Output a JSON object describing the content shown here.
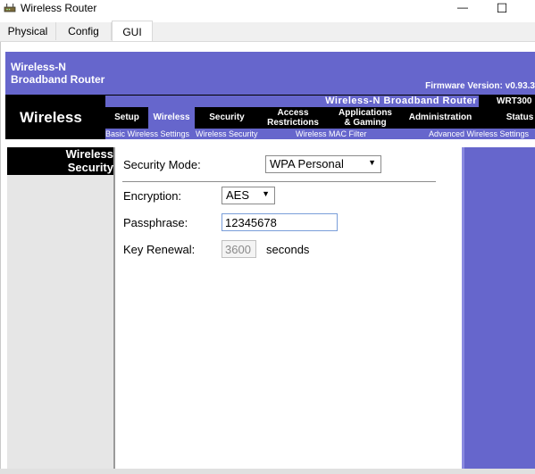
{
  "window": {
    "title": "Wireless Router",
    "minimize_glyph": "—",
    "maximize_glyph": "☐"
  },
  "tabs": [
    {
      "label": "Physical",
      "active": false
    },
    {
      "label": "Config",
      "active": false
    },
    {
      "label": "GUI",
      "active": true
    }
  ],
  "header": {
    "brand_line1": "Wireless-N",
    "brand_line2": "Broadband Router",
    "firmware": "Firmware Version: v0.93.3",
    "section_title": "Wireless",
    "product_name": "Wireless-N Broadband Router",
    "model": "WRT300"
  },
  "menu": [
    {
      "label": "Setup"
    },
    {
      "label": "Wireless",
      "active": true
    },
    {
      "label": "Security"
    },
    {
      "label_line1": "Access",
      "label_line2": "Restrictions"
    },
    {
      "label_line1": "Applications",
      "label_line2": "& Gaming"
    },
    {
      "label": "Administration"
    },
    {
      "label": "Status"
    }
  ],
  "submenu": [
    {
      "label": "Basic Wireless Settings"
    },
    {
      "label": "Wireless Security",
      "active": true
    },
    {
      "label": "Wireless MAC Filter"
    },
    {
      "label": "Advanced Wireless Settings"
    }
  ],
  "left_panel": {
    "line1": "Wireless",
    "line2": "Security"
  },
  "form": {
    "security_mode_label": "Security Mode:",
    "security_mode_value": "WPA Personal",
    "encryption_label": "Encryption:",
    "encryption_value": "AES",
    "passphrase_label": "Passphrase:",
    "passphrase_value": "12345678",
    "key_renewal_label": "Key Renewal:",
    "key_renewal_value": "3600",
    "key_renewal_unit": "seconds"
  },
  "colors": {
    "brand_purple": "#6666cc",
    "header_black": "#000000"
  }
}
